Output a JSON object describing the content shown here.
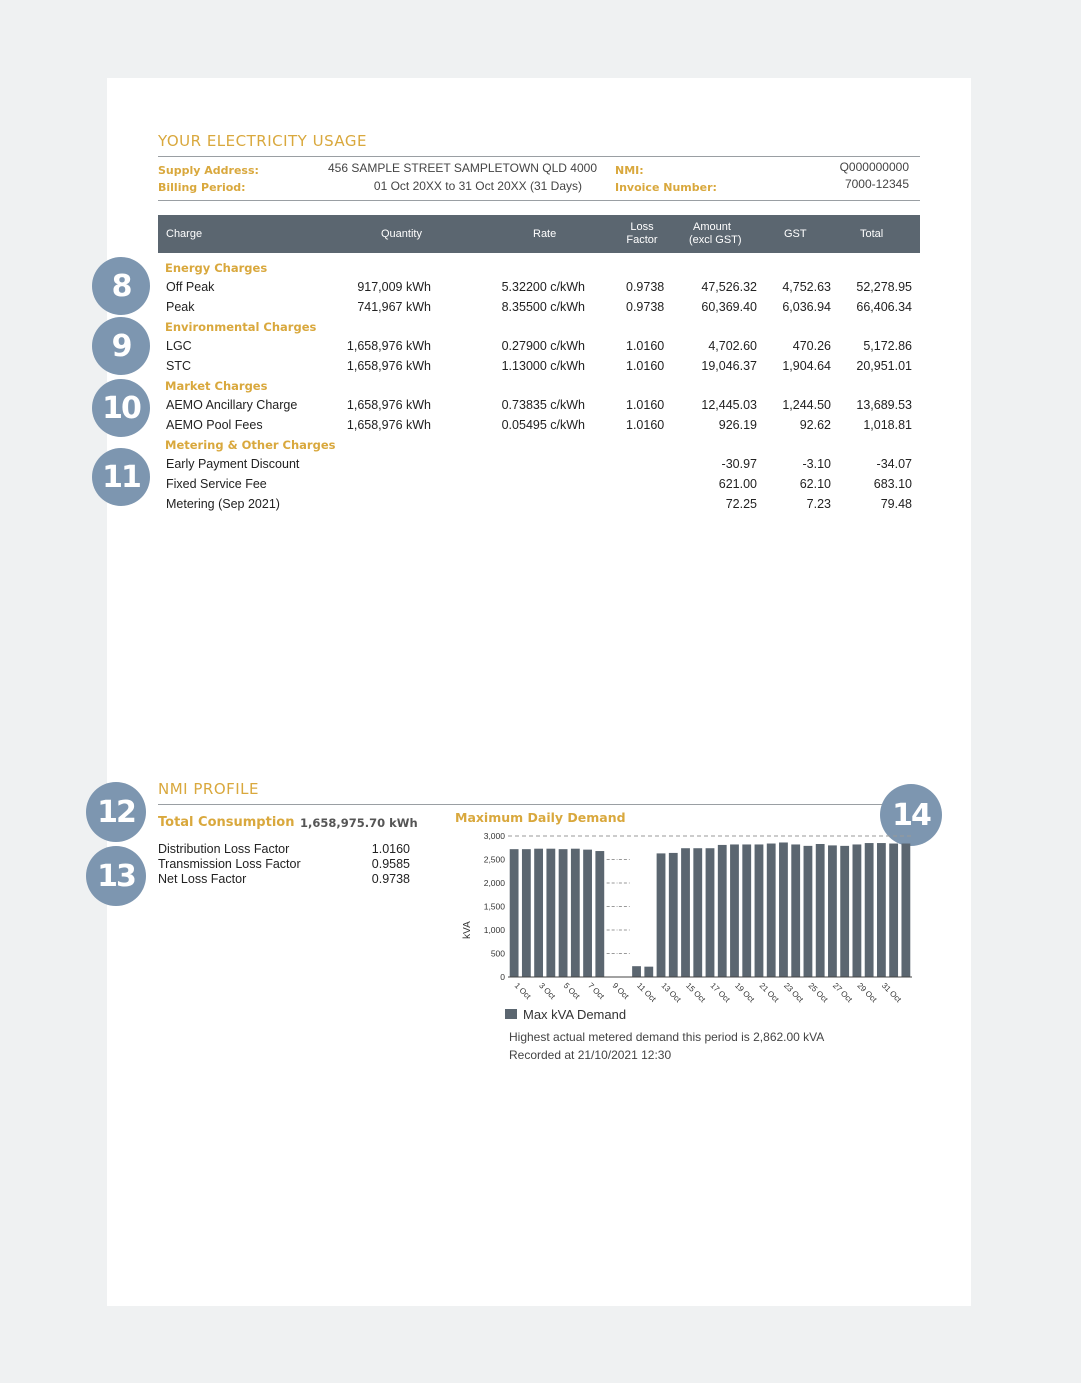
{
  "usage": {
    "title": "YOUR ELECTRICITY USAGE",
    "supply_address_label": "Supply Address:",
    "supply_address": "456 SAMPLE STREET SAMPLETOWN QLD 4000",
    "billing_period_label": "Billing Period:",
    "billing_period": "01 Oct 20XX to 31 Oct 20XX (31 Days)",
    "nmi_label": "NMI:",
    "nmi": "Q000000000",
    "invoice_label": "Invoice Number:",
    "invoice": "7000-12345"
  },
  "table": {
    "headers": {
      "charge": "Charge",
      "quantity": "Quantity",
      "rate": "Rate",
      "loss1": "Loss",
      "loss2": "Factor",
      "amount1": "Amount",
      "amount2": "(excl GST)",
      "gst": "GST",
      "total": "Total"
    },
    "sections": [
      {
        "name": "Energy Charges",
        "rows": [
          {
            "charge": "Off Peak",
            "quantity": "917,009 kWh",
            "rate": "5.32200 c/kWh",
            "loss": "0.9738",
            "amount": "47,526.32",
            "gst": "4,752.63",
            "total": "52,278.95"
          },
          {
            "charge": "Peak",
            "quantity": "741,967 kWh",
            "rate": "8.35500 c/kWh",
            "loss": "0.9738",
            "amount": "60,369.40",
            "gst": "6,036.94",
            "total": "66,406.34"
          }
        ]
      },
      {
        "name": "Environmental Charges",
        "rows": [
          {
            "charge": "LGC",
            "quantity": "1,658,976 kWh",
            "rate": "0.27900 c/kWh",
            "loss": "1.0160",
            "amount": "4,702.60",
            "gst": "470.26",
            "total": "5,172.86"
          },
          {
            "charge": "STC",
            "quantity": "1,658,976 kWh",
            "rate": "1.13000 c/kWh",
            "loss": "1.0160",
            "amount": "19,046.37",
            "gst": "1,904.64",
            "total": "20,951.01"
          }
        ]
      },
      {
        "name": "Market Charges",
        "rows": [
          {
            "charge": "AEMO Ancillary Charge",
            "quantity": "1,658,976 kWh",
            "rate": "0.73835 c/kWh",
            "loss": "1.0160",
            "amount": "12,445.03",
            "gst": "1,244.50",
            "total": "13,689.53"
          },
          {
            "charge": "AEMO Pool Fees",
            "quantity": "1,658,976 kWh",
            "rate": "0.05495 c/kWh",
            "loss": "1.0160",
            "amount": "926.19",
            "gst": "92.62",
            "total": "1,018.81"
          }
        ]
      },
      {
        "name": "Metering & Other Charges",
        "rows": [
          {
            "charge": "Early Payment Discount",
            "quantity": "",
            "rate": "",
            "loss": "",
            "amount": "-30.97",
            "gst": "-3.10",
            "total": "-34.07"
          },
          {
            "charge": "Fixed Service Fee",
            "quantity": "",
            "rate": "",
            "loss": "",
            "amount": "621.00",
            "gst": "62.10",
            "total": "683.10"
          },
          {
            "charge": "Metering (Sep 2021)",
            "quantity": "",
            "rate": "",
            "loss": "",
            "amount": "72.25",
            "gst": "7.23",
            "total": "79.48"
          }
        ]
      }
    ]
  },
  "badges": {
    "b8": "8",
    "b9": "9",
    "b10": "10",
    "b11": "11",
    "b12": "12",
    "b13": "13",
    "b14": "14"
  },
  "profile": {
    "title": "NMI PROFILE",
    "total_label": "Total Consumption",
    "total_value": "1,658,975.70 kWh",
    "factors": [
      {
        "label": "Distribution Loss Factor",
        "value": "1.0160"
      },
      {
        "label": "Transmission Loss Factor",
        "value": "0.9585"
      },
      {
        "label": "Net Loss Factor",
        "value": "0.9738"
      }
    ],
    "chart_title": "Maximum Daily Demand",
    "legend": "Max kVA Demand",
    "note1": "Highest actual metered demand this period is 2,862.00  kVA",
    "note2": "Recorded at 21/10/2021 12:30"
  },
  "colors": {
    "gold": "#d9a83d",
    "header_gray": "#5b6670",
    "bar": "#5b6670",
    "badge": "#7d96b0"
  },
  "chart_data": {
    "type": "bar",
    "ylabel": "kVA",
    "ylim": [
      0,
      3000
    ],
    "yticks": [
      "0",
      "500",
      "1,000",
      "1,500",
      "2,000",
      "2,500",
      "3,000"
    ],
    "xtick_labels": [
      "1 Oct",
      "3 Oct",
      "5 Oct",
      "7 Oct",
      "9 Oct",
      "11 Oct",
      "13 Oct",
      "15 Oct",
      "17 Oct",
      "19 Oct",
      "21 Oct",
      "23 Oct",
      "25 Oct",
      "27 Oct",
      "29 Oct",
      "31 Oct"
    ],
    "series": [
      {
        "name": "Max kVA Demand",
        "values": [
          2720,
          2720,
          2730,
          2730,
          2720,
          2730,
          2710,
          2680,
          0,
          0,
          230,
          220,
          2630,
          2640,
          2740,
          2740,
          2740,
          2810,
          2820,
          2820,
          2820,
          2840,
          2862,
          2820,
          2790,
          2830,
          2800,
          2790,
          2820,
          2850,
          2850,
          2840,
          2840
        ]
      }
    ]
  }
}
